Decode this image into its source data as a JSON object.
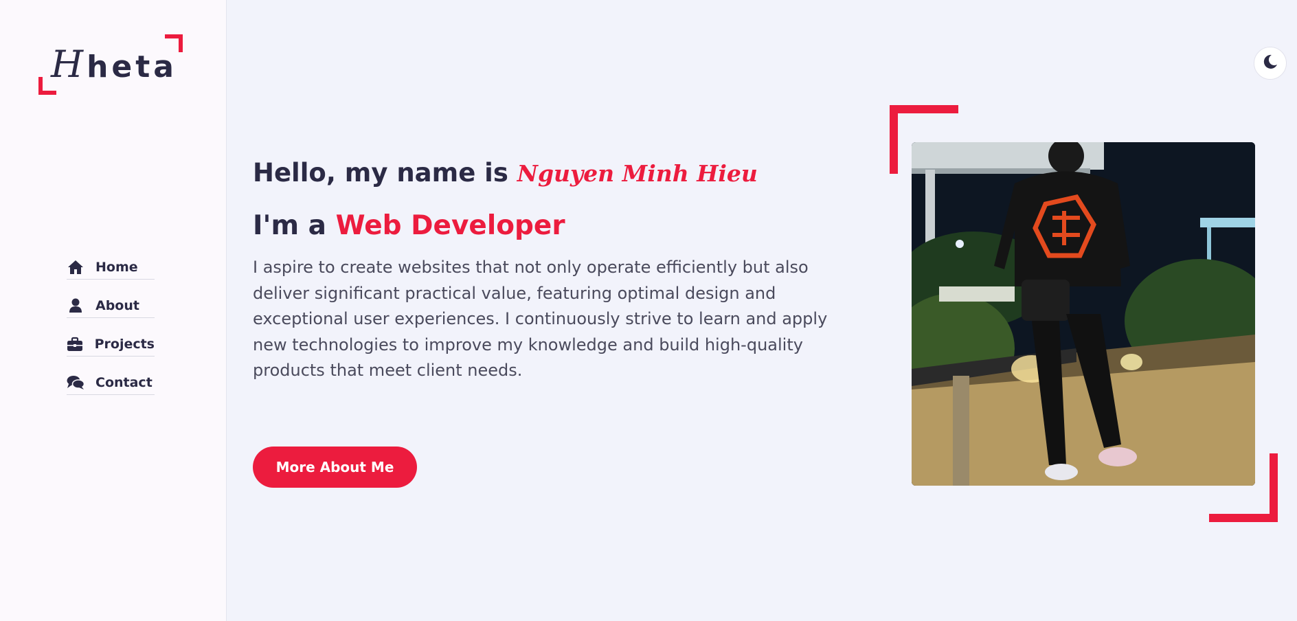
{
  "logo": {
    "initial": "H",
    "rest": "heta"
  },
  "nav": {
    "items": [
      {
        "label": "Home",
        "icon": "home-icon"
      },
      {
        "label": "About",
        "icon": "user-icon"
      },
      {
        "label": "Projects",
        "icon": "briefcase-icon"
      },
      {
        "label": "Contact",
        "icon": "comments-icon"
      }
    ]
  },
  "theme_toggle": {
    "icon": "moon-icon"
  },
  "hero": {
    "greeting_prefix": "Hello, my name is",
    "name": "Nguyen Minh Hieu",
    "role_prefix": "I'm a",
    "role": "Web Developer",
    "bio": "I aspire to create websites that not only operate efficiently but also deliver significant practical value, featuring optimal design and exceptional user experiences. I continuously strive to learn and apply new technologies to improve my knowledge and build high-quality products that meet client needs.",
    "cta_label": "More About Me"
  },
  "colors": {
    "accent": "#ec1c3e",
    "text": "#2b2a45",
    "background": "#f2f3fb",
    "sidebar": "#fcf9fd"
  }
}
